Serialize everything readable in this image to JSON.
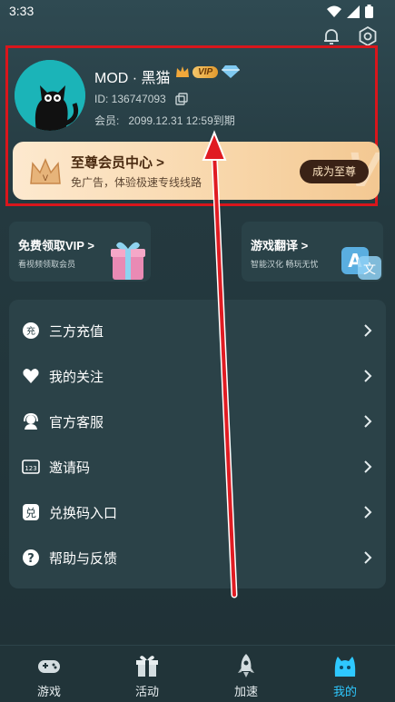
{
  "status": {
    "time": "3:33"
  },
  "profile": {
    "username": "MOD · 黑猫",
    "vip_badge": "VIP",
    "uid": "ID: 136747093",
    "member_label": "会员:",
    "member_expiry": "2099.12.31 12:59到期"
  },
  "vip_banner": {
    "title": "至尊会员中心 >",
    "subtitle": "免广告，体验极速专线线路",
    "button": "成为至尊",
    "watermark": "V"
  },
  "promos": [
    {
      "title": "免费领取VIP >",
      "subtitle": "看视频领取会员"
    },
    {
      "title": "游戏翻译 >",
      "subtitle": "智能汉化 畅玩无忧"
    }
  ],
  "menu": [
    {
      "label": "三方充值",
      "icon": "recharge-icon"
    },
    {
      "label": "我的关注",
      "icon": "heart-icon"
    },
    {
      "label": "官方客服",
      "icon": "headset-icon"
    },
    {
      "label": "邀请码",
      "icon": "invite-code-icon"
    },
    {
      "label": "兑换码入口",
      "icon": "redeem-icon"
    },
    {
      "label": "帮助与反馈",
      "icon": "help-icon"
    }
  ],
  "tabs": [
    {
      "label": "游戏",
      "icon": "gamepad-icon"
    },
    {
      "label": "活动",
      "icon": "gift-icon"
    },
    {
      "label": "加速",
      "icon": "rocket-icon"
    },
    {
      "label": "我的",
      "icon": "profile-cat-icon"
    }
  ],
  "colors": {
    "accent": "#2ec8ff",
    "highlight_box": "#d9161c",
    "vip_gold": "#e39b2e"
  }
}
